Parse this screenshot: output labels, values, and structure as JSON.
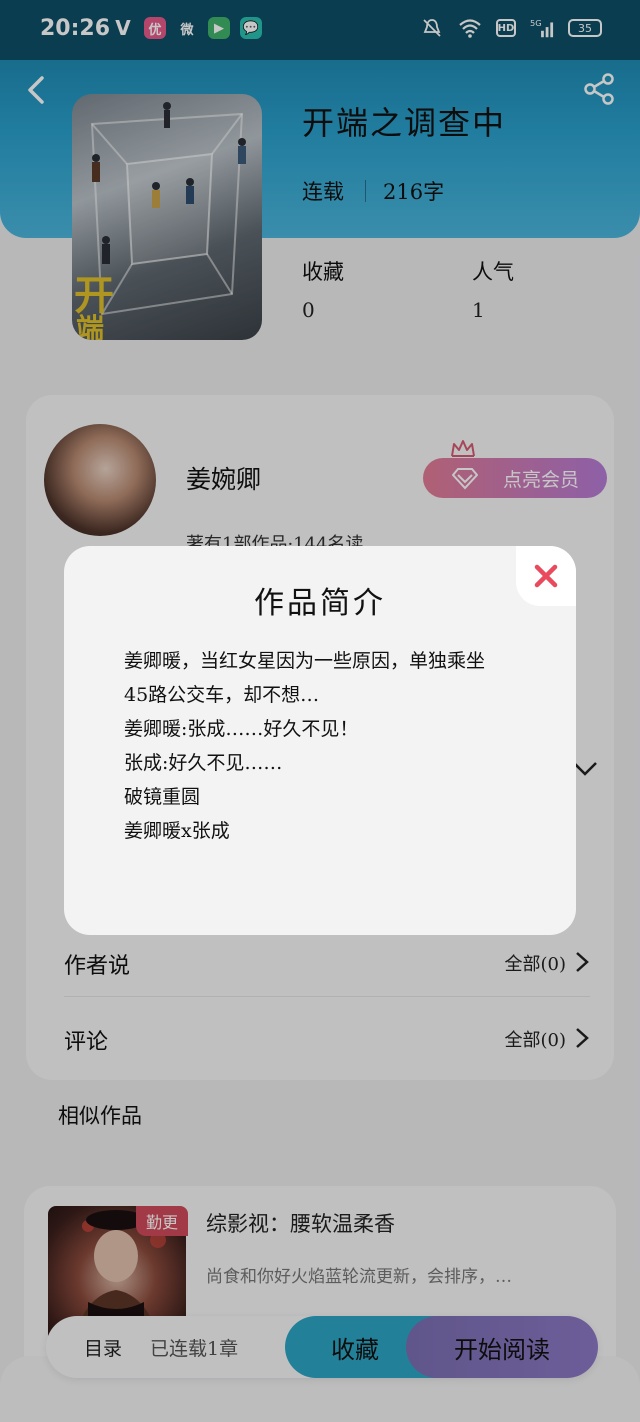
{
  "status_bar": {
    "time": "20:26",
    "apps": [
      "V",
      "优",
      "微",
      "▶",
      "💬"
    ],
    "network": "HD",
    "signal": "5G",
    "battery": "35"
  },
  "book": {
    "title": "开端之调查中",
    "status": "连载",
    "words": "216字",
    "stats": [
      {
        "label": "收藏",
        "value": "0"
      },
      {
        "label": "人气",
        "value": "1"
      }
    ]
  },
  "author": {
    "name": "姜婉卿",
    "works_text": "著有1部作品·144名读",
    "vip_label": "点亮会员"
  },
  "rows": [
    {
      "label": "作者说",
      "right": "全部(0)"
    },
    {
      "label": "评论",
      "right": "全部(0)"
    }
  ],
  "similar": {
    "title": "相似作品",
    "items": [
      {
        "name": "综影视：腰软温柔香",
        "badge": "勤更",
        "desc": "尚食和你好火焰蓝轮流更新，会排序，…"
      }
    ]
  },
  "bottom_bar": {
    "toc_label": "目录",
    "toc_count": "已连载1章",
    "favorite_label": "收藏",
    "read_label": "开始阅读"
  },
  "modal": {
    "title": "作品简介",
    "lines": [
      "姜卿暖，当红女星因为一些原因，单独乘坐",
      "45路公交车，却不想…",
      "姜卿暖:张成……好久不见！",
      "张成:好久不见……",
      "破镜重圆",
      "姜卿暖x张成"
    ]
  },
  "colors": {
    "header": "#2aa0cc",
    "vip_gradient_start": "#e27c95",
    "vip_gradient_end": "#b67cd6",
    "favorite_button": "#2ca6c4",
    "read_button": "#8c78c4",
    "close_icon": "#e94a5e",
    "badge": "#d04a5a"
  }
}
